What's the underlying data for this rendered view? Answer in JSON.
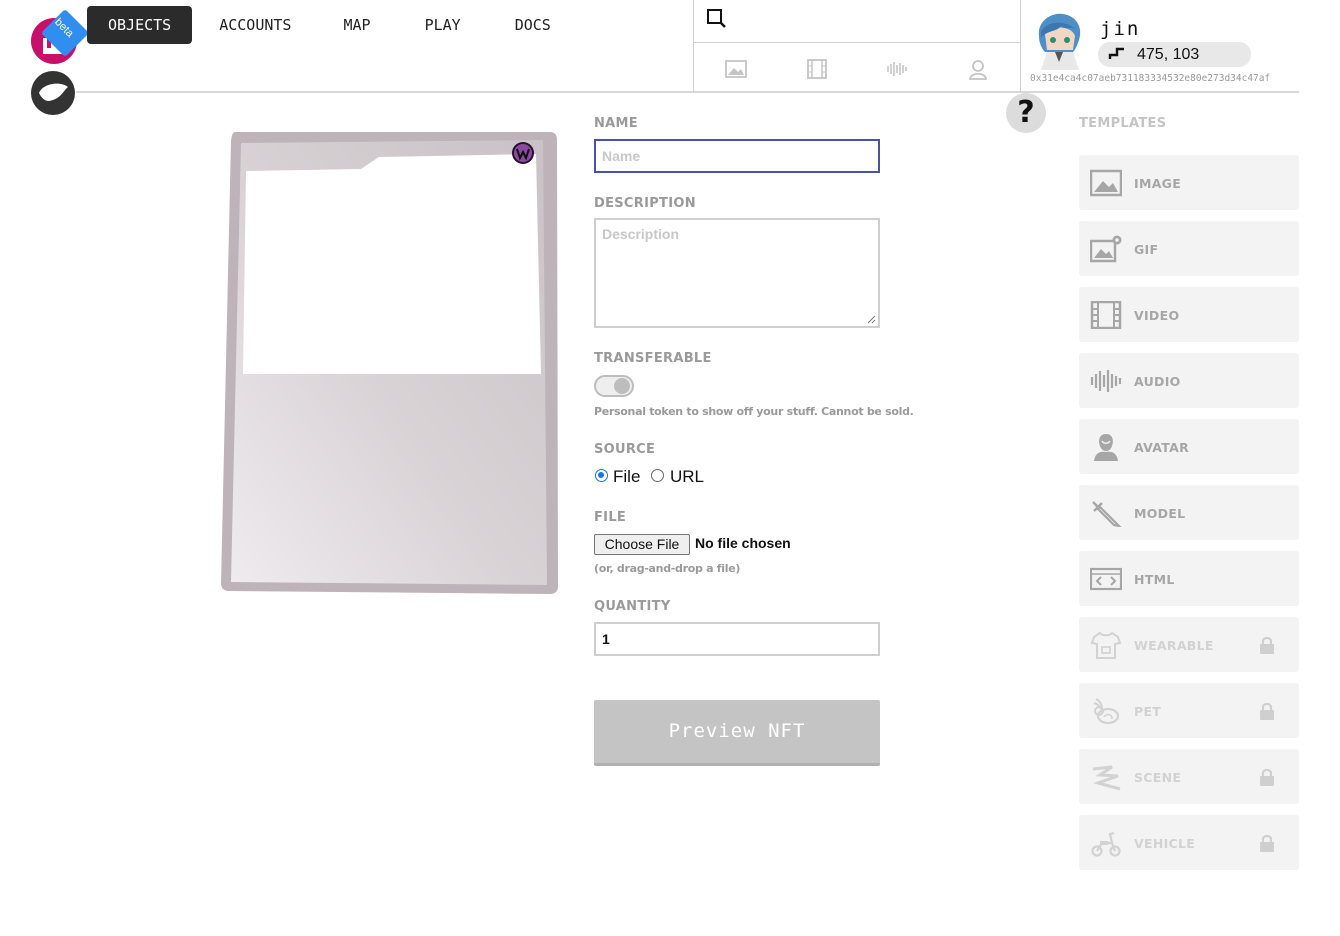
{
  "logo": {
    "beta_label": "beta"
  },
  "nav": {
    "items": [
      "OBJECTS",
      "ACCOUNTS",
      "MAP",
      "PLAY",
      "DOCS"
    ],
    "active": "OBJECTS"
  },
  "search": {
    "filters": [
      "image-filter-icon",
      "video-filter-icon",
      "audio-filter-icon",
      "avatar-filter-icon"
    ]
  },
  "user": {
    "name": "jin",
    "coords": "475, 103",
    "address": "0x31e4ca4c07aeb731183334532e80e273d34c47af"
  },
  "help": {
    "label": "?"
  },
  "form": {
    "name_label": "NAME",
    "name_placeholder": "Name",
    "description_label": "DESCRIPTION",
    "description_placeholder": "Description",
    "transferable_label": "TRANSFERABLE",
    "transferable_hint": "Personal token to show off your stuff. Cannot be sold.",
    "source_label": "SOURCE",
    "source_options": [
      "File",
      "URL"
    ],
    "source_selected": "File",
    "file_label": "FILE",
    "file_button": "Choose File",
    "file_status": "No file chosen",
    "file_hint": "(or, drag-and-drop a file)",
    "quantity_label": "QUANTITY",
    "quantity_value": "1",
    "preview_button": "Preview NFT"
  },
  "templates": {
    "title": "TEMPLATES",
    "items": [
      {
        "label": "IMAGE",
        "icon": "image-icon",
        "locked": false
      },
      {
        "label": "GIF",
        "icon": "gif-icon",
        "locked": false
      },
      {
        "label": "VIDEO",
        "icon": "film-icon",
        "locked": false
      },
      {
        "label": "AUDIO",
        "icon": "audio-wave-icon",
        "locked": false
      },
      {
        "label": "AVATAR",
        "icon": "avatar-icon",
        "locked": false
      },
      {
        "label": "MODEL",
        "icon": "sword-icon",
        "locked": false
      },
      {
        "label": "HTML",
        "icon": "code-icon",
        "locked": false
      },
      {
        "label": "WEARABLE",
        "icon": "shirt-icon",
        "locked": true
      },
      {
        "label": "PET",
        "icon": "rabbit-icon",
        "locked": true
      },
      {
        "label": "SCENE",
        "icon": "scene-icon",
        "locked": true
      },
      {
        "label": "VEHICLE",
        "icon": "scooter-icon",
        "locked": true
      }
    ]
  },
  "colors": {
    "accent": "#2b2b2b",
    "brand": "#c8106a",
    "beta": "#2f8ef0",
    "focus": "#4a52a8",
    "preview": "#c4c4c4"
  }
}
